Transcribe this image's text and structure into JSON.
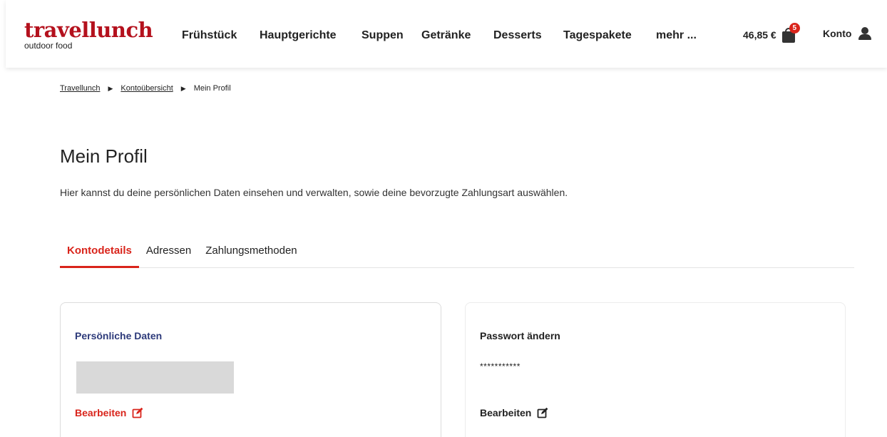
{
  "header": {
    "logo_main": "travellunch",
    "logo_sub": "outdoor food",
    "nav": [
      "Frühstück",
      "Hauptgerichte",
      "Suppen",
      "Getränke",
      "Desserts",
      "Tagespakete",
      "mehr ..."
    ],
    "cart_total": "46,85 €",
    "cart_count": "5",
    "account_label": "Konto",
    "brand_color": "#b4111d",
    "accent_color": "#d9241b"
  },
  "breadcrumb": {
    "items": [
      "Travellunch",
      "Kontoübersicht",
      "Mein Profil"
    ],
    "separator": "▶"
  },
  "page": {
    "title": "Mein Profil",
    "intro": "Hier kannst du deine persönlichen Daten einsehen und verwalten, sowie deine bevorzugte Zahlungsart auswählen."
  },
  "tabs": [
    {
      "label": "Kontodetails",
      "active": true
    },
    {
      "label": "Adressen",
      "active": false
    },
    {
      "label": "Zahlungsmethoden",
      "active": false
    }
  ],
  "cards": {
    "personal": {
      "title": "Persönliche Daten",
      "edit_label": "Bearbeiten"
    },
    "password": {
      "title": "Passwort ändern",
      "masked_value": "***********",
      "edit_label": "Bearbeiten"
    }
  },
  "icons": {
    "cart": "shopping-bag-icon",
    "account": "user-icon",
    "edit": "edit-icon",
    "breadcrumb_sep": "triangle-right-icon"
  }
}
